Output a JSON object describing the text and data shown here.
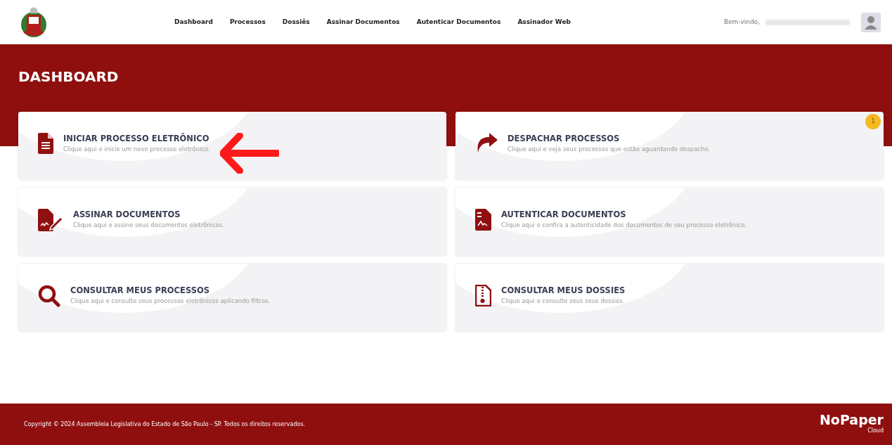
{
  "header": {
    "nav": [
      {
        "label": "Dashboard"
      },
      {
        "label": "Processos"
      },
      {
        "label": "Dossiês"
      },
      {
        "label": "Assinar Documentos"
      },
      {
        "label": "Autenticar Documentos"
      },
      {
        "label": "Assinador Web"
      }
    ],
    "welcome": "Bem-vindo,"
  },
  "page_title": "DASHBOARD",
  "cards": [
    {
      "kind": "document",
      "title": "INICIAR PROCESSO ELETRÔNICO",
      "description": "Clique aqui e inicie um novo processo eletrônico.",
      "pointer_arrow": true
    },
    {
      "kind": "forward",
      "title": "DESPACHAR PROCESSOS",
      "description": "Clique aqui e veja seus processos que estão aguardando despacho.",
      "badge": "1"
    },
    {
      "kind": "sign",
      "title": "ASSINAR DOCUMENTOS",
      "description": "Clique aqui e assine seus documentos eletrônicos."
    },
    {
      "kind": "certificate",
      "title": "AUTENTICAR DOCUMENTOS",
      "description": "Clique aqui e confira a autenticidade dos documentos de seu processo eletrônico."
    },
    {
      "kind": "search",
      "title": "CONSULTAR MEUS PROCESSOS",
      "description": "Clique aqui e consulte seus processos eletrônicos aplicando filtros."
    },
    {
      "kind": "archive",
      "title": "CONSULTAR MEUS DOSSIES",
      "description": "Clique aqui e consulte seus seus dossies."
    }
  ],
  "footer": {
    "copyright": "Copyright © 2024 Assembleia Legislativa do Estado de São Paulo - SP. Todos os direitos reservados.",
    "logo": "NoPaper",
    "logo_sub": "Cloud"
  }
}
